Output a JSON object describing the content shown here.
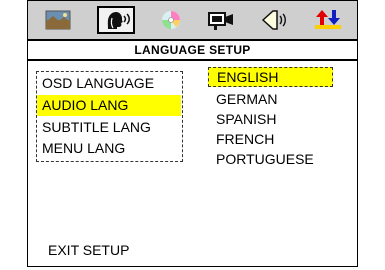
{
  "tabs": [
    {
      "icon": "landscape-picture-icon",
      "selected": false
    },
    {
      "icon": "speaking-head-icon",
      "selected": true
    },
    {
      "icon": "disc-icon",
      "selected": false
    },
    {
      "icon": "video-camera-icon",
      "selected": false
    },
    {
      "icon": "speaker-icon",
      "selected": false
    },
    {
      "icon": "preferences-icon",
      "selected": false
    }
  ],
  "title": "LANGUAGE SETUP",
  "menu": {
    "items": [
      "OSD LANGUAGE",
      "AUDIO LANG",
      "SUBTITLE LANG",
      "MENU LANG"
    ],
    "highlighted": "AUDIO LANG"
  },
  "options": {
    "items": [
      "ENGLISH",
      "GERMAN",
      "SPANISH",
      "FRENCH",
      "PORTUGUESE"
    ],
    "selected": "ENGLISH"
  },
  "exit_label": "EXIT SETUP",
  "colors": {
    "highlight": "#ffff00",
    "tabbar_bg": "#cfcfcf",
    "pref_arrow_red": "#e00000",
    "pref_arrow_blue": "#1020c0"
  }
}
